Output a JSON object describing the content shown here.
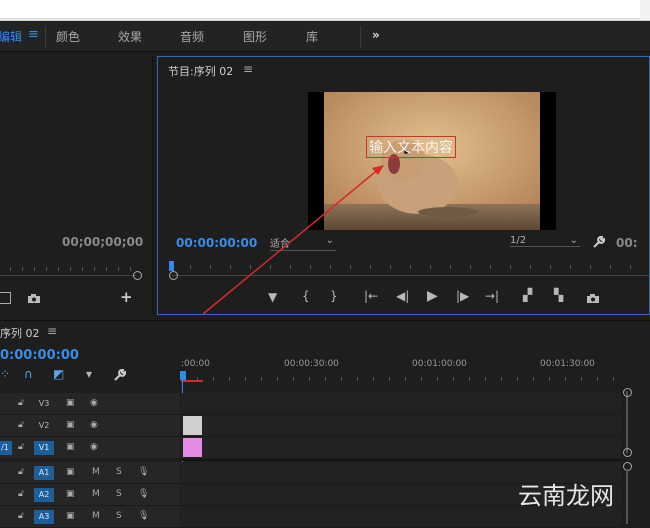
{
  "workspace": {
    "items": [
      "编辑",
      "颜色",
      "效果",
      "音频",
      "图形",
      "库"
    ],
    "menu_icon": "hamburger-icon",
    "more_icon": "chevron-double-right-icon"
  },
  "source_monitor": {
    "timecode": "00;00;00;00"
  },
  "program_monitor": {
    "title": "节目:序列 02",
    "menu_icon": "hamburger-icon",
    "timecode": "00:00:00:00",
    "fit_label": "适合",
    "resolution_label": "1/2",
    "right_timecode": "00:",
    "video_text": "输入文本内容"
  },
  "timeline": {
    "title": "序列 02",
    "timecode": "0:00:00:00",
    "ruler_labels": [
      ":00:00",
      "00:00:30:00",
      "00:01:00:00",
      "00:01:30:00"
    ],
    "video_tracks": [
      "V3",
      "V2",
      "V1"
    ],
    "audio_tracks": [
      "A1",
      "A2",
      "A3"
    ],
    "v1_source_label": "/1",
    "mute_label": "M",
    "solo_label": "S"
  },
  "watermark": {
    "text": "云南龙网"
  },
  "colors": {
    "accent": "#2d8ceb",
    "panel_border": "#2d6db5",
    "track_blue": "#1f5f99",
    "clip_v2": "#cfcfcf",
    "clip_v1": "#e58be3",
    "arrow": "#d42a2a"
  }
}
